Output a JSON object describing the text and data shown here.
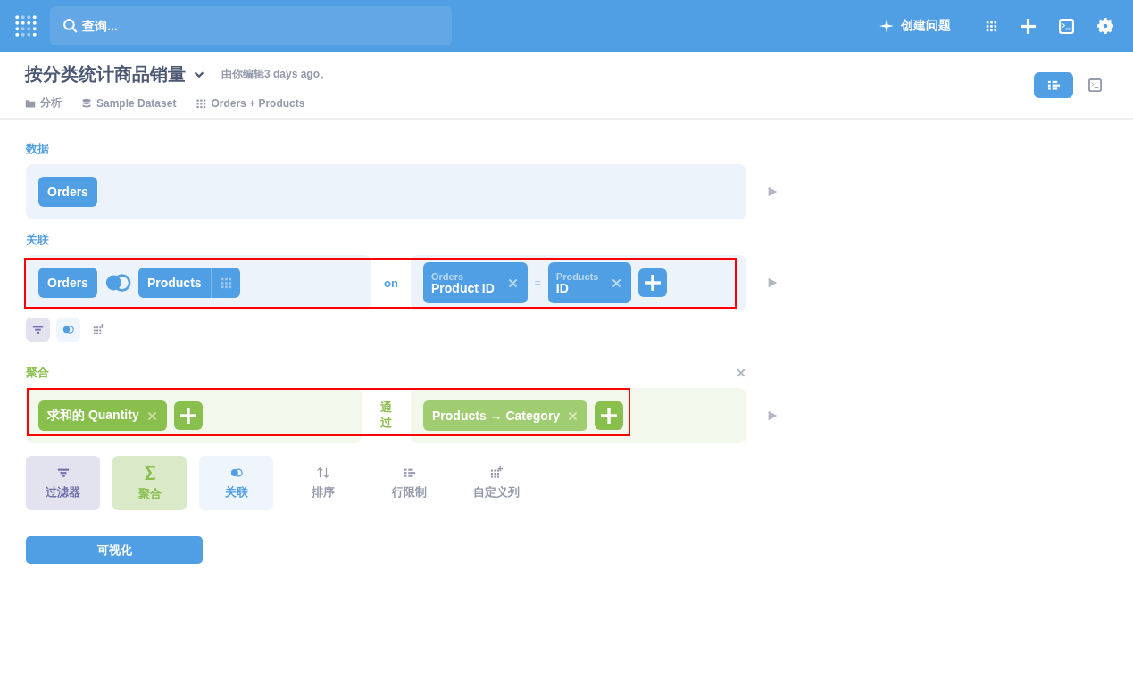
{
  "topbar": {
    "search": {
      "placeholder": "查询..."
    },
    "new_question": "创建问题"
  },
  "question": {
    "title": "按分类统计商品销量",
    "edited": "由你编辑3 days ago。",
    "breadcrumbs": [
      {
        "kind": "collection",
        "label": "分析"
      },
      {
        "kind": "database",
        "label": "Sample Dataset"
      },
      {
        "kind": "table",
        "label": "Orders + Products"
      }
    ]
  },
  "view_toggle": [
    {
      "kind": "editor",
      "selected": true
    },
    {
      "kind": "sql",
      "selected": false
    }
  ],
  "steps": [
    {
      "kind": "data",
      "label": "数据",
      "table": "Orders"
    },
    {
      "kind": "join",
      "label": "关联",
      "highlighted": true,
      "left_table": "Orders",
      "right_table": "Products",
      "on": "on",
      "conditions": [
        {
          "left_table": "Orders",
          "left_field": "Product ID",
          "operator": "=",
          "right_table": "Products",
          "right_field": "ID"
        }
      ],
      "actions": [
        {
          "kind": "filter"
        },
        {
          "kind": "join"
        },
        {
          "kind": "custom"
        }
      ]
    },
    {
      "kind": "summarize",
      "label": "聚合",
      "highlighted": true,
      "metrics": [
        "求和的 Quantity"
      ],
      "by": "通过",
      "breakouts": [
        "Products → Category"
      ]
    }
  ],
  "actions": [
    {
      "kind": "filter",
      "label": "过滤器"
    },
    {
      "kind": "summarize",
      "label": "聚合"
    },
    {
      "kind": "join",
      "label": "关联"
    },
    {
      "kind": "sort",
      "label": "排序"
    },
    {
      "kind": "limit",
      "label": "行限制"
    },
    {
      "kind": "custom",
      "label": "自定义列"
    }
  ],
  "visualize": "可视化"
}
